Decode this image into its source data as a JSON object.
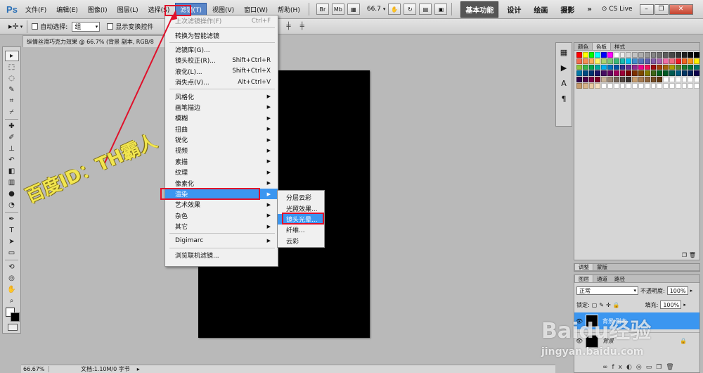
{
  "menubar": {
    "logo": "Ps",
    "items": [
      "文件(F)",
      "编辑(E)",
      "图像(I)",
      "图层(L)",
      "选择(S)",
      "滤镜(T)",
      "视图(V)",
      "窗口(W)",
      "帮助(H)"
    ],
    "zoom": "66.7",
    "workspaces": [
      "基本功能",
      "设计",
      "绘画",
      "摄影"
    ],
    "more": "»",
    "cslive": "CS Live"
  },
  "options": {
    "auto_select_label": "自动选择:",
    "auto_select_value": "组",
    "show_transform_label": "显示变换控件"
  },
  "doc_tab": "纵情丝滑巧克力效果 @ 66.7% (背景 副本, RGB/8",
  "filter_menu": {
    "items": [
      {
        "label": "上次滤镜操作(F)",
        "shortcut": "Ctrl+F",
        "disabled": true
      },
      {
        "sep": true
      },
      {
        "label": "转换为智能滤镜"
      },
      {
        "sep": true
      },
      {
        "label": "滤镜库(G)..."
      },
      {
        "label": "镜头校正(R)...",
        "shortcut": "Shift+Ctrl+R"
      },
      {
        "label": "液化(L)...",
        "shortcut": "Shift+Ctrl+X"
      },
      {
        "label": "消失点(V)...",
        "shortcut": "Alt+Ctrl+V"
      },
      {
        "sep": true
      },
      {
        "label": "风格化",
        "sub": true
      },
      {
        "label": "画笔描边",
        "sub": true
      },
      {
        "label": "模糊",
        "sub": true
      },
      {
        "label": "扭曲",
        "sub": true
      },
      {
        "label": "锐化",
        "sub": true
      },
      {
        "label": "视频",
        "sub": true
      },
      {
        "label": "素描",
        "sub": true
      },
      {
        "label": "纹理",
        "sub": true
      },
      {
        "label": "像素化",
        "sub": true
      },
      {
        "label": "渲染",
        "sub": true,
        "highlight": true
      },
      {
        "label": "艺术效果",
        "sub": true
      },
      {
        "label": "杂色",
        "sub": true
      },
      {
        "label": "其它",
        "sub": true
      },
      {
        "sep": true
      },
      {
        "label": "Digimarc",
        "sub": true
      },
      {
        "sep": true
      },
      {
        "label": "浏览联机滤镜..."
      }
    ]
  },
  "render_submenu": {
    "items": [
      "分层云彩",
      "光照效果...",
      "镜头光晕...",
      "纤维...",
      "云彩"
    ],
    "highlight_index": 2
  },
  "watermark": "百度ID：TH霸人",
  "statusbar": {
    "zoom": "66.67%",
    "doc_info": "文档:1.10M/0 字节"
  },
  "swatches_panel": {
    "tabs": [
      "颜色",
      "色板",
      "样式"
    ],
    "selected": "色板"
  },
  "adjust_panel": {
    "tabs": [
      "调整",
      "蒙版"
    ]
  },
  "layers_panel": {
    "tabs": [
      "图层",
      "通道",
      "路径"
    ],
    "blend_mode": "正常",
    "opacity_label": "不透明度:",
    "opacity": "100%",
    "lock_label": "锁定:",
    "fill_label": "填充:",
    "fill": "100%",
    "layers": [
      "背景 副本",
      "背景"
    ]
  },
  "baidu_watermark": "Baidu经验",
  "baidu_url": "jingyan.baidu.com",
  "colors": {
    "accent": "#3b96f0",
    "annotation": "#e0102a",
    "watermark": "#f4e84a"
  }
}
